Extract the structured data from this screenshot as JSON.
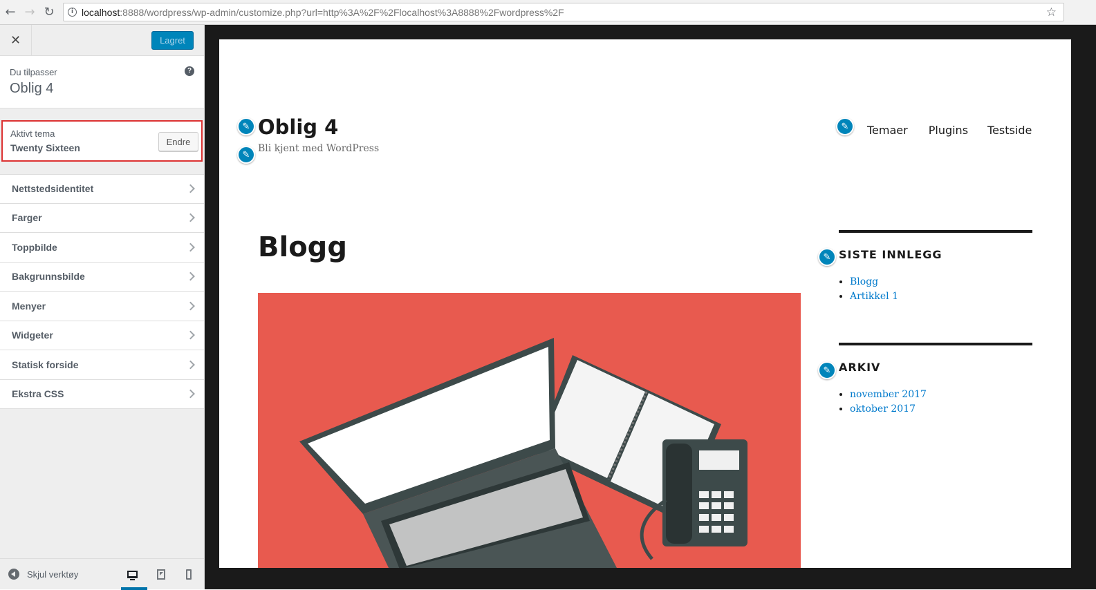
{
  "browser": {
    "url_host": "localhost",
    "url_rest": ":8888/wordpress/wp-admin/customize.php?url=http%3A%2F%2Flocalhost%3A8888%2Fwordpress%2F",
    "back_icon": "arrow-left",
    "forward_icon": "arrow-right",
    "reload_icon": "reload",
    "star_icon": "star"
  },
  "sidebar": {
    "close_icon": "close",
    "save_label": "Lagret",
    "info_label": "Du tilpasser",
    "info_title": "Oblig 4",
    "help_icon": "?",
    "theme_label": "Aktivt tema",
    "theme_name": "Twenty Sixteen",
    "change_label": "Endre",
    "menu": [
      {
        "label": "Nettstedsidentitet"
      },
      {
        "label": "Farger"
      },
      {
        "label": "Toppbilde"
      },
      {
        "label": "Bakgrunnsbilde"
      },
      {
        "label": "Menyer"
      },
      {
        "label": "Widgeter"
      },
      {
        "label": "Statisk forside"
      },
      {
        "label": "Ekstra CSS"
      }
    ],
    "footer": {
      "collapse_label": "Skjul verktøy",
      "devices": [
        "desktop",
        "tablet",
        "mobile"
      ],
      "active_device": "desktop"
    }
  },
  "site": {
    "title": "Oblig 4",
    "description": "Bli kjent med WordPress",
    "nav": [
      "Temaer",
      "Plugins",
      "Testside"
    ],
    "page_title": "Blogg",
    "widgets": [
      {
        "title": "SISTE INNLEGG",
        "items": [
          "Blogg",
          "Artikkel 1"
        ]
      },
      {
        "title": "ARKIV",
        "items": [
          "november 2017",
          "oktober 2017"
        ]
      }
    ]
  },
  "colors": {
    "accent": "#0085ba",
    "highlight_border": "#dc3232",
    "hero_bg": "#e85a4f",
    "link": "#007acc"
  }
}
